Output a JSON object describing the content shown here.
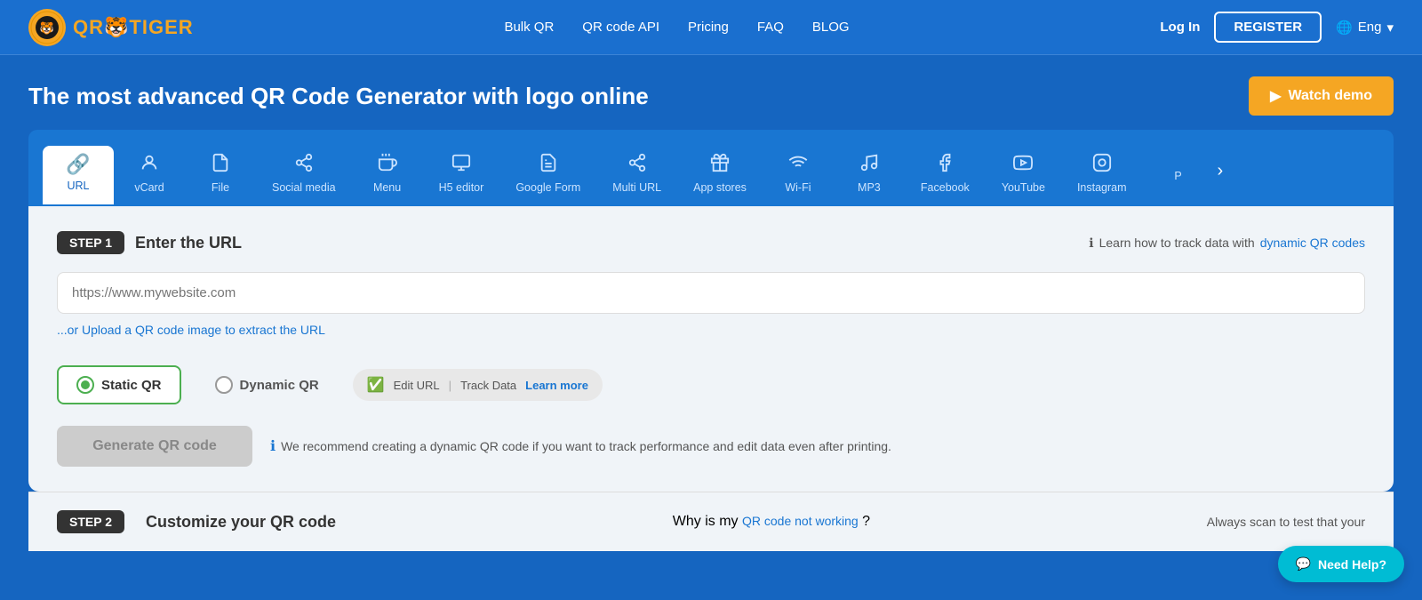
{
  "header": {
    "logo_text_qr": "QR",
    "logo_text_tiger": "TIGER",
    "nav": {
      "bulk_qr": "Bulk QR",
      "qr_code_api": "QR code API",
      "pricing": "Pricing",
      "faq": "FAQ",
      "blog": "BLOG"
    },
    "login_label": "Log In",
    "register_label": "REGISTER",
    "lang_label": "Eng"
  },
  "hero": {
    "title": "The most advanced QR Code Generator with logo online",
    "watch_demo_label": "Watch demo"
  },
  "tabs": [
    {
      "id": "url",
      "label": "URL",
      "icon": "🔗",
      "active": true
    },
    {
      "id": "vcard",
      "label": "vCard",
      "icon": "👤",
      "active": false
    },
    {
      "id": "file",
      "label": "File",
      "icon": "📄",
      "active": false
    },
    {
      "id": "social-media",
      "label": "Social media",
      "icon": "💬",
      "active": false
    },
    {
      "id": "menu",
      "label": "Menu",
      "icon": "☕",
      "active": false
    },
    {
      "id": "h5-editor",
      "label": "H5 editor",
      "icon": "🖥",
      "active": false
    },
    {
      "id": "google-form",
      "label": "Google Form",
      "icon": "📋",
      "active": false
    },
    {
      "id": "multi-url",
      "label": "Multi URL",
      "icon": "🔀",
      "active": false
    },
    {
      "id": "app-stores",
      "label": "App stores",
      "icon": "🛍",
      "active": false
    },
    {
      "id": "wifi",
      "label": "Wi-Fi",
      "icon": "📶",
      "active": false
    },
    {
      "id": "mp3",
      "label": "MP3",
      "icon": "🎵",
      "active": false
    },
    {
      "id": "facebook",
      "label": "Facebook",
      "icon": "🅕",
      "active": false
    },
    {
      "id": "youtube",
      "label": "YouTube",
      "icon": "▶",
      "active": false
    },
    {
      "id": "instagram",
      "label": "Instagram",
      "icon": "📷",
      "active": false
    },
    {
      "id": "more",
      "label": "P",
      "icon": "",
      "active": false
    }
  ],
  "step1": {
    "badge": "STEP 1",
    "title": "Enter the URL",
    "track_info": "Learn how to track data with",
    "track_link": "dynamic QR codes",
    "url_placeholder": "https://www.mywebsite.com",
    "upload_link": "...or Upload a QR code image to extract the URL",
    "static_qr_label": "Static QR",
    "dynamic_qr_label": "Dynamic QR",
    "edit_url_label": "Edit URL",
    "track_data_label": "Track Data",
    "learn_more_label": "Learn more",
    "generate_btn_label": "Generate QR code",
    "recommend_text": "We recommend creating a dynamic QR code if you want to track performance and edit data even after printing."
  },
  "step2": {
    "badge": "STEP 2",
    "title": "Customize your QR code",
    "qr_not_working_text": "Why is my",
    "qr_not_working_link": "QR code not working",
    "qr_not_working_suffix": "?",
    "always_scan_text": "Always scan to test that your"
  },
  "need_help": {
    "label": "Need Help?"
  }
}
